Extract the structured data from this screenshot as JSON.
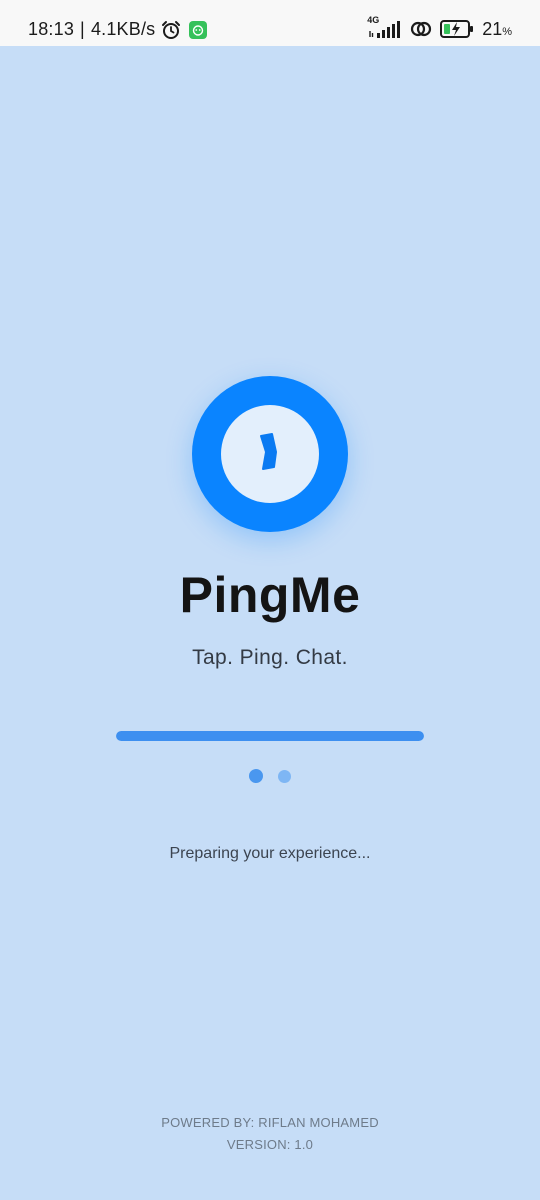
{
  "status_bar": {
    "time": "18:13",
    "separator": "|",
    "net_speed": "4.1KB/s",
    "network_type": "4G",
    "battery_percent": "21",
    "battery_unit": "%",
    "icons": [
      "alarm-icon",
      "app-notification-icon",
      "signal-icon",
      "hotspot-link-icon",
      "battery-charging-icon"
    ]
  },
  "app": {
    "title": "PingMe",
    "tagline": "Tap. Ping. Chat.",
    "loading_message": "Preparing your experience...",
    "progress": 1.0,
    "logo_icon": "ping-bubble-icon"
  },
  "footer": {
    "powered_by": "POWERED BY: RIFLAN MOHAMED",
    "version": "VERSION: 1.0"
  },
  "colors": {
    "background": "#c6ddf7",
    "accent": "#0a84ff",
    "progress": "#3d8ff0"
  }
}
